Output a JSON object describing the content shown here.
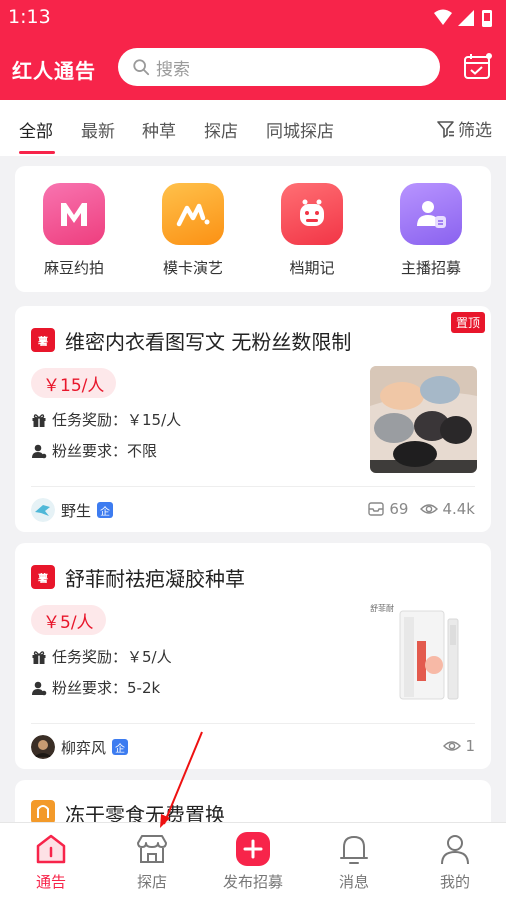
{
  "status_bar": {
    "time": "1:13"
  },
  "header": {
    "app_title": "红人通告",
    "search_placeholder": "搜索",
    "brand_color": "#f7244a"
  },
  "tabs": {
    "items": [
      {
        "label": "全部",
        "active": true
      },
      {
        "label": "最新"
      },
      {
        "label": "种草"
      },
      {
        "label": "探店"
      },
      {
        "label": "同城探店"
      }
    ],
    "filter_label": "筛选"
  },
  "quick_entries": [
    {
      "label": "麻豆约拍",
      "icon": "m-logo-icon",
      "color": "#f0508f"
    },
    {
      "label": "模卡演艺",
      "icon": "m-card-icon",
      "color": "#fda324"
    },
    {
      "label": "档期记",
      "icon": "schedule-monster-icon",
      "color": "#f94a55"
    },
    {
      "label": "主播招募",
      "icon": "streamer-icon",
      "color": "#9a73f3"
    }
  ],
  "tasks": [
    {
      "pin_label": "置顶",
      "tag": "薯",
      "title": "维密内衣看图写文 无粉丝数限制",
      "price": "￥15/人",
      "reward_label": "任务奖励：￥15/人",
      "fans_label": "粉丝要求：不限",
      "author": "野生",
      "ent_badge": "企",
      "applies": "69",
      "views": "4.4k"
    },
    {
      "tag": "薯",
      "title": "舒菲耐祛疤凝胶种草",
      "price": "￥5/人",
      "reward_label": "任务奖励：￥5/人",
      "fans_label": "粉丝要求：5-2k",
      "author": "柳弈风",
      "ent_badge": "企",
      "views": "1",
      "thumb_text": "舒菲耐"
    },
    {
      "title": "冻干零食无费置换"
    }
  ],
  "bottom_nav": [
    {
      "label": "通告",
      "active": true
    },
    {
      "label": "探店"
    },
    {
      "label": "发布招募"
    },
    {
      "label": "消息"
    },
    {
      "label": "我的"
    }
  ]
}
